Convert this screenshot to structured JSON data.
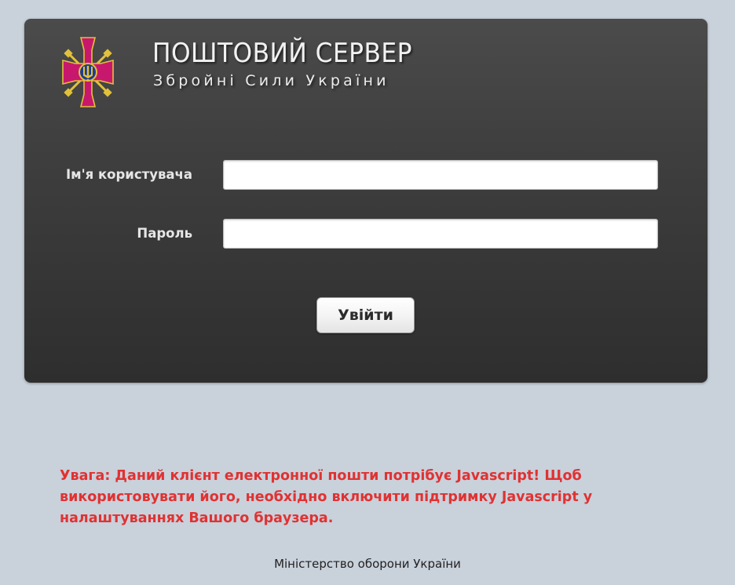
{
  "header": {
    "title": "ПОШТОВИЙ СЕРВЕР",
    "subtitle": "Збройні Сили України",
    "emblem_icon": "armed-forces-ukraine-emblem-icon"
  },
  "form": {
    "username_label": "Ім'я користувача",
    "username_value": "",
    "password_label": "Пароль",
    "password_value": "",
    "submit_label": "Увійти"
  },
  "warning": {
    "text": "Увага: Даний клієнт електронної пошти потрібує Javascript! Щоб використовувати його, необхідно включити підтримку Javascript у налаштуваннях Вашого браузера."
  },
  "footer": {
    "text": "Міністерство оборони України"
  },
  "colors": {
    "page_background": "#c9d1db",
    "panel_background": "#3a3a3a",
    "warning_text": "#e03232",
    "emblem_cross": "#c8186e",
    "emblem_gold": "#e2c13a"
  }
}
